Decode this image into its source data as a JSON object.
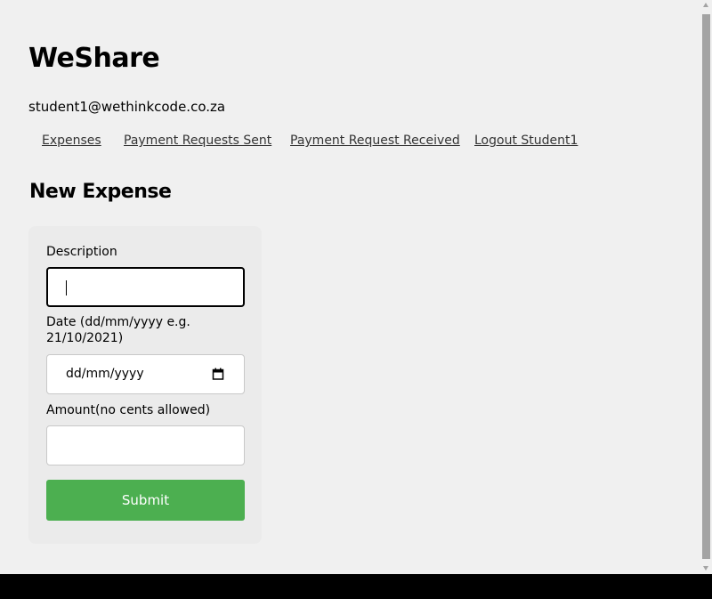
{
  "app": {
    "title": "WeShare",
    "user_email": "student1@wethinkcode.co.za"
  },
  "nav": {
    "expenses": "Expenses",
    "payment_requests_sent": "Payment Requests Sent",
    "payment_request_received": "Payment Request Received",
    "logout": "Logout Student1"
  },
  "form": {
    "heading": "New Expense",
    "description_label": "Description",
    "description_value": "",
    "date_label": "Date (dd/mm/yyyy e.g. 21/10/2021)",
    "date_placeholder": "dd/mm/yyyy",
    "amount_label": "Amount(no cents allowed)",
    "amount_value": "",
    "submit_label": "Submit"
  },
  "colors": {
    "accent": "#4caf50",
    "page_background": "#f0f0f0",
    "card_background": "#ebebeb"
  },
  "icons": {
    "date_picker": "calendar-icon",
    "scroll_up": "scroll-up-arrow-icon",
    "scroll_down": "scroll-down-arrow-icon"
  }
}
